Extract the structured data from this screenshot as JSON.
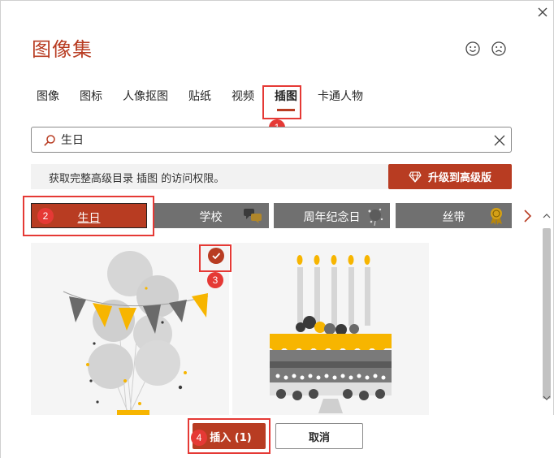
{
  "dialog": {
    "title": "图像集"
  },
  "tabs": [
    {
      "label": "图像"
    },
    {
      "label": "图标"
    },
    {
      "label": "人像抠图"
    },
    {
      "label": "贴纸"
    },
    {
      "label": "视频"
    },
    {
      "label": "插图",
      "active": true
    },
    {
      "label": "卡通人物"
    }
  ],
  "search": {
    "value": "生日"
  },
  "notice": {
    "text": "获取完整高级目录 插图 的访问权限。",
    "upgrade_label": "升级到高级版"
  },
  "categories": [
    {
      "label": "生日",
      "active": true
    },
    {
      "label": "学校"
    },
    {
      "label": "周年纪念日"
    },
    {
      "label": "丝带"
    }
  ],
  "results": [
    {
      "name": "balloons-illustration",
      "selected": true
    },
    {
      "name": "birthday-cake-illustration",
      "selected": false
    }
  ],
  "footer": {
    "insert_label": "插入 (1)",
    "cancel_label": "取消"
  },
  "annotations": [
    "1",
    "2",
    "3",
    "4"
  ],
  "colors": {
    "accent": "#b83c22",
    "category_bg": "#707070",
    "callout": "#e53935",
    "yellow": "#f7b500",
    "illustration_gray": "#d3d3d3"
  },
  "icons": [
    "close-icon",
    "smile-icon",
    "frown-icon",
    "search-icon",
    "clear-icon",
    "diamond-icon",
    "chevron-right-icon",
    "checkmark-icon",
    "chevron-up-icon",
    "chevron-down-icon"
  ]
}
